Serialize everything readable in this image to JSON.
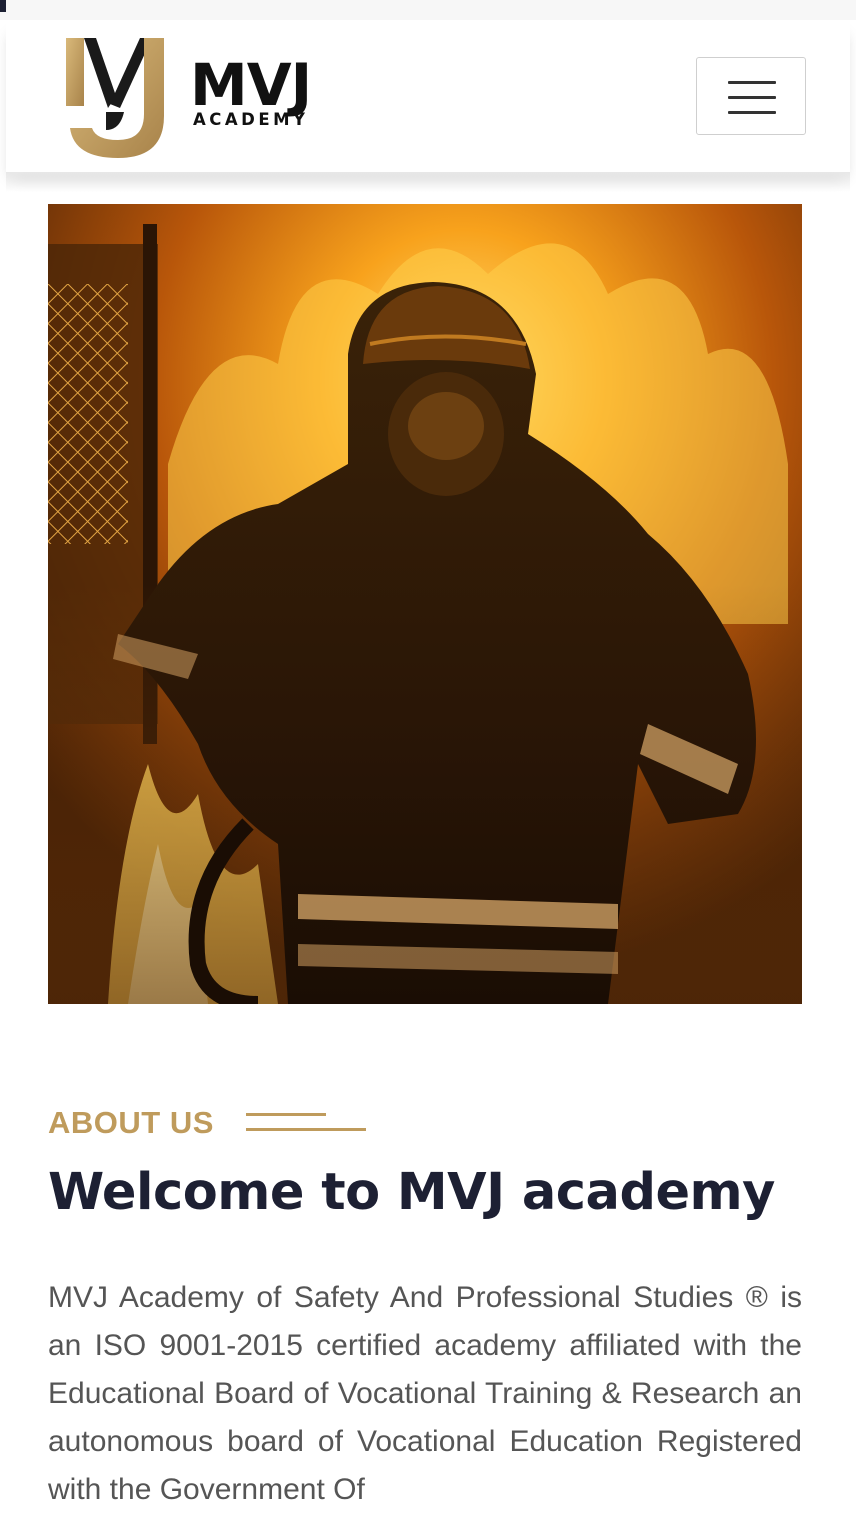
{
  "header": {
    "logo_text": "MVJ",
    "logo_subtext": "ACADEMY",
    "menu_icon": "hamburger-menu-icon"
  },
  "hero": {
    "image": "firefighter-in-flames"
  },
  "about": {
    "label": "ABOUT US",
    "title": "Welcome to MVJ academy",
    "body": "MVJ Academy of Safety And Professional Studies ® is an ISO 9001-2015 certified academy affiliated with the Educational Board of Vocational Training & Research an autonomous board of Vocational Education Registered with the Government Of"
  },
  "colors": {
    "gold": "#bf9b5c",
    "navy": "#1d2033",
    "text": "#555555"
  }
}
